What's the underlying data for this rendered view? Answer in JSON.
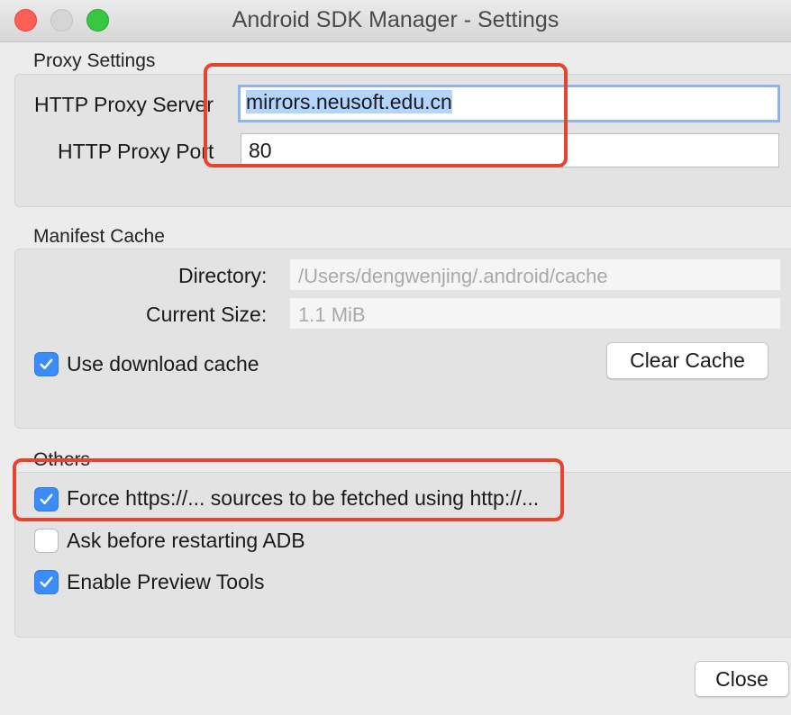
{
  "window": {
    "title": "Android SDK Manager - Settings"
  },
  "proxy": {
    "section_label": "Proxy Settings",
    "server_label": "HTTP Proxy Server",
    "server_value": "mirrors.neusoft.edu.cn",
    "port_label": "HTTP Proxy Port",
    "port_value": "80"
  },
  "manifest": {
    "section_label": "Manifest Cache",
    "directory_label": "Directory:",
    "directory_value": "/Users/dengwenjing/.android/cache",
    "size_label": "Current Size:",
    "size_value": "1.1 MiB",
    "use_cache_label": "Use download cache",
    "use_cache_checked": true,
    "clear_cache_label": "Clear Cache"
  },
  "others": {
    "section_label": "Others",
    "force_http_label": "Force https://... sources to be fetched using http://...",
    "force_http_checked": true,
    "ask_restart_label": "Ask before restarting ADB",
    "ask_restart_checked": false,
    "preview_tools_label": "Enable Preview Tools",
    "preview_tools_checked": true
  },
  "footer": {
    "close_label": "Close"
  },
  "colors": {
    "annotation": "#e9422e",
    "checkbox_checked": "#3b8cf7",
    "focus_ring": "#8fb3ea"
  }
}
